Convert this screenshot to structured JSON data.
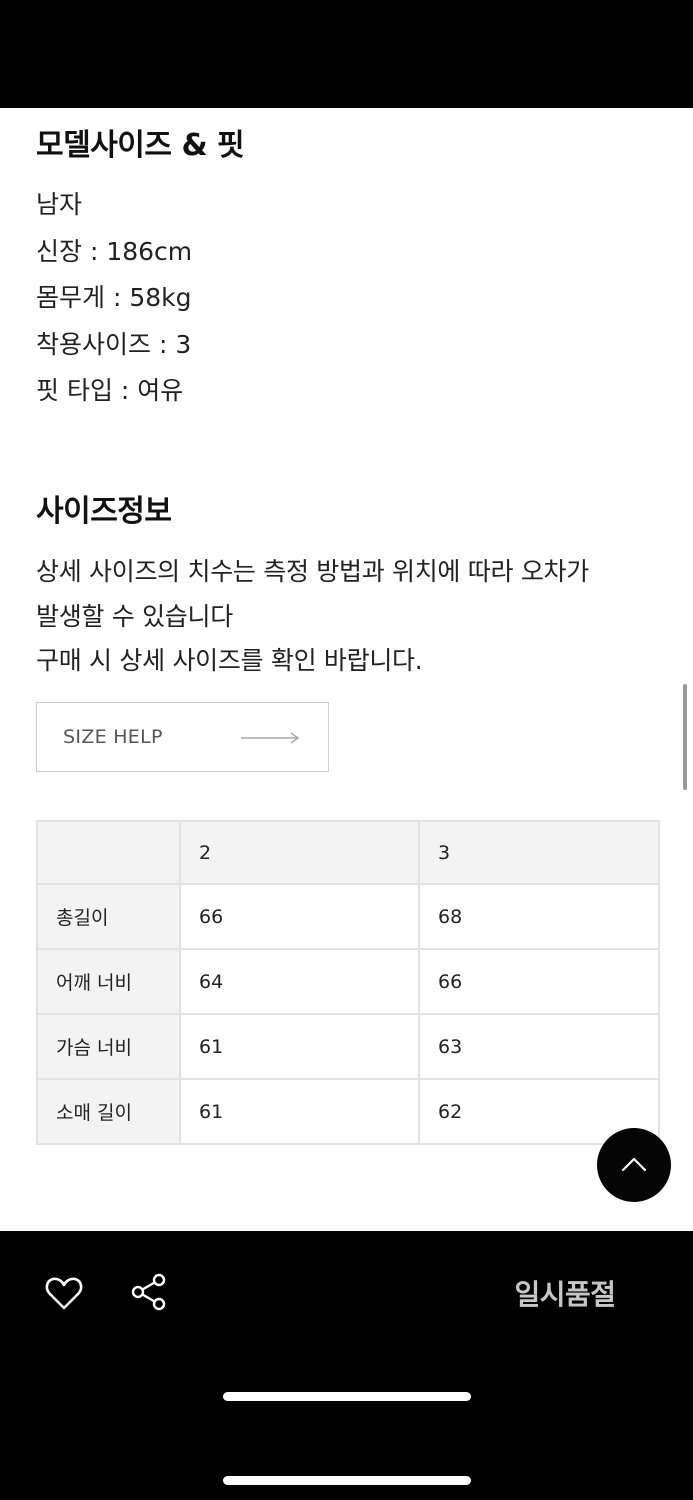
{
  "model": {
    "title": "모델사이즈 & 핏",
    "lines": [
      "남자",
      "신장 : 186cm",
      "몸무게 : 58kg",
      "착용사이즈 : 3",
      "핏 타입 : 여유"
    ]
  },
  "size_info": {
    "title": "사이즈정보",
    "desc_lines": [
      "상세 사이즈의 치수는 측정 방법과 위치에 따라 오차가",
      "발생할 수 있습니다",
      "구매 시 상세 사이즈를 확인 바랍니다."
    ],
    "help_button": "SIZE HELP"
  },
  "size_table": {
    "headers": [
      "",
      "2",
      "3"
    ],
    "rows": [
      [
        "총길이",
        "66",
        "68"
      ],
      [
        "어깨 너비",
        "64",
        "66"
      ],
      [
        "가슴 너비",
        "61",
        "63"
      ],
      [
        "소매 길이",
        "61",
        "62"
      ]
    ]
  },
  "bottom_bar": {
    "status_label": "일시품절",
    "icons": [
      "heart-icon",
      "share-icon"
    ]
  },
  "colors": {
    "background": "#ffffff",
    "bar": "#000000",
    "table_header_bg": "#f3f3f3",
    "soldout_text": "#c7c7c7"
  }
}
